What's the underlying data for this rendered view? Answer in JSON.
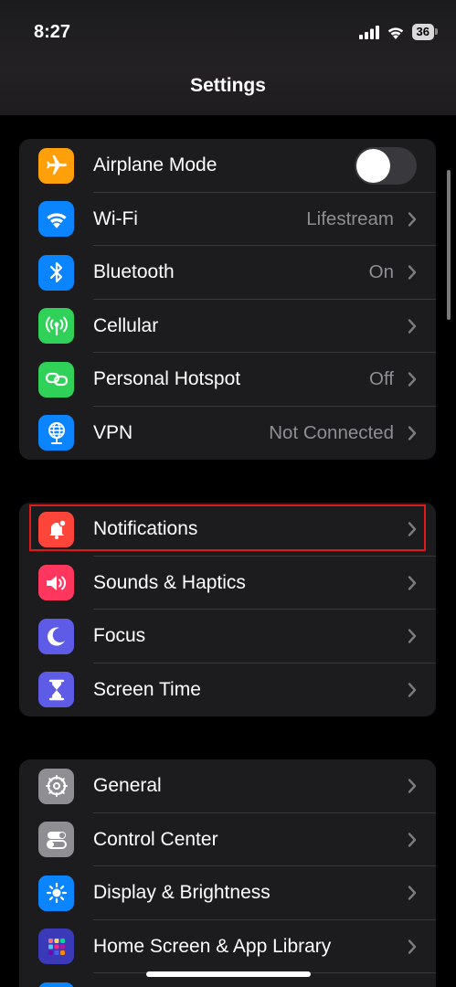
{
  "status_bar": {
    "time": "8:27",
    "battery": "36"
  },
  "nav": {
    "title": "Settings"
  },
  "groups": [
    [
      {
        "label": "Airplane Mode",
        "icon": "airplane-icon",
        "color": "#ff9f0a",
        "toggle": false
      },
      {
        "label": "Wi-Fi",
        "value": "Lifestream",
        "icon": "wifi-icon",
        "color": "#0a84ff"
      },
      {
        "label": "Bluetooth",
        "value": "On",
        "icon": "bluetooth-icon",
        "color": "#0a84ff"
      },
      {
        "label": "Cellular",
        "value": "",
        "icon": "cellular-icon",
        "color": "#30d158"
      },
      {
        "label": "Personal Hotspot",
        "value": "Off",
        "icon": "hotspot-icon",
        "color": "#30d158"
      },
      {
        "label": "VPN",
        "value": "Not Connected",
        "icon": "globe-icon",
        "color": "#0a84ff"
      }
    ],
    [
      {
        "label": "Notifications",
        "icon": "bell-icon",
        "color": "#ff453a"
      },
      {
        "label": "Sounds & Haptics",
        "icon": "speaker-icon",
        "color": "#ff375f"
      },
      {
        "label": "Focus",
        "icon": "moon-icon",
        "color": "#5e5ce6"
      },
      {
        "label": "Screen Time",
        "icon": "hourglass-icon",
        "color": "#5e5ce6"
      }
    ],
    [
      {
        "label": "General",
        "icon": "gear-icon",
        "color": "#8e8e93"
      },
      {
        "label": "Control Center",
        "icon": "toggles-icon",
        "color": "#8e8e93"
      },
      {
        "label": "Display & Brightness",
        "icon": "sun-icon",
        "color": "#0a84ff"
      },
      {
        "label": "Home Screen & App Library",
        "icon": "grid-icon",
        "color": "#5e5ce6"
      }
    ]
  ]
}
